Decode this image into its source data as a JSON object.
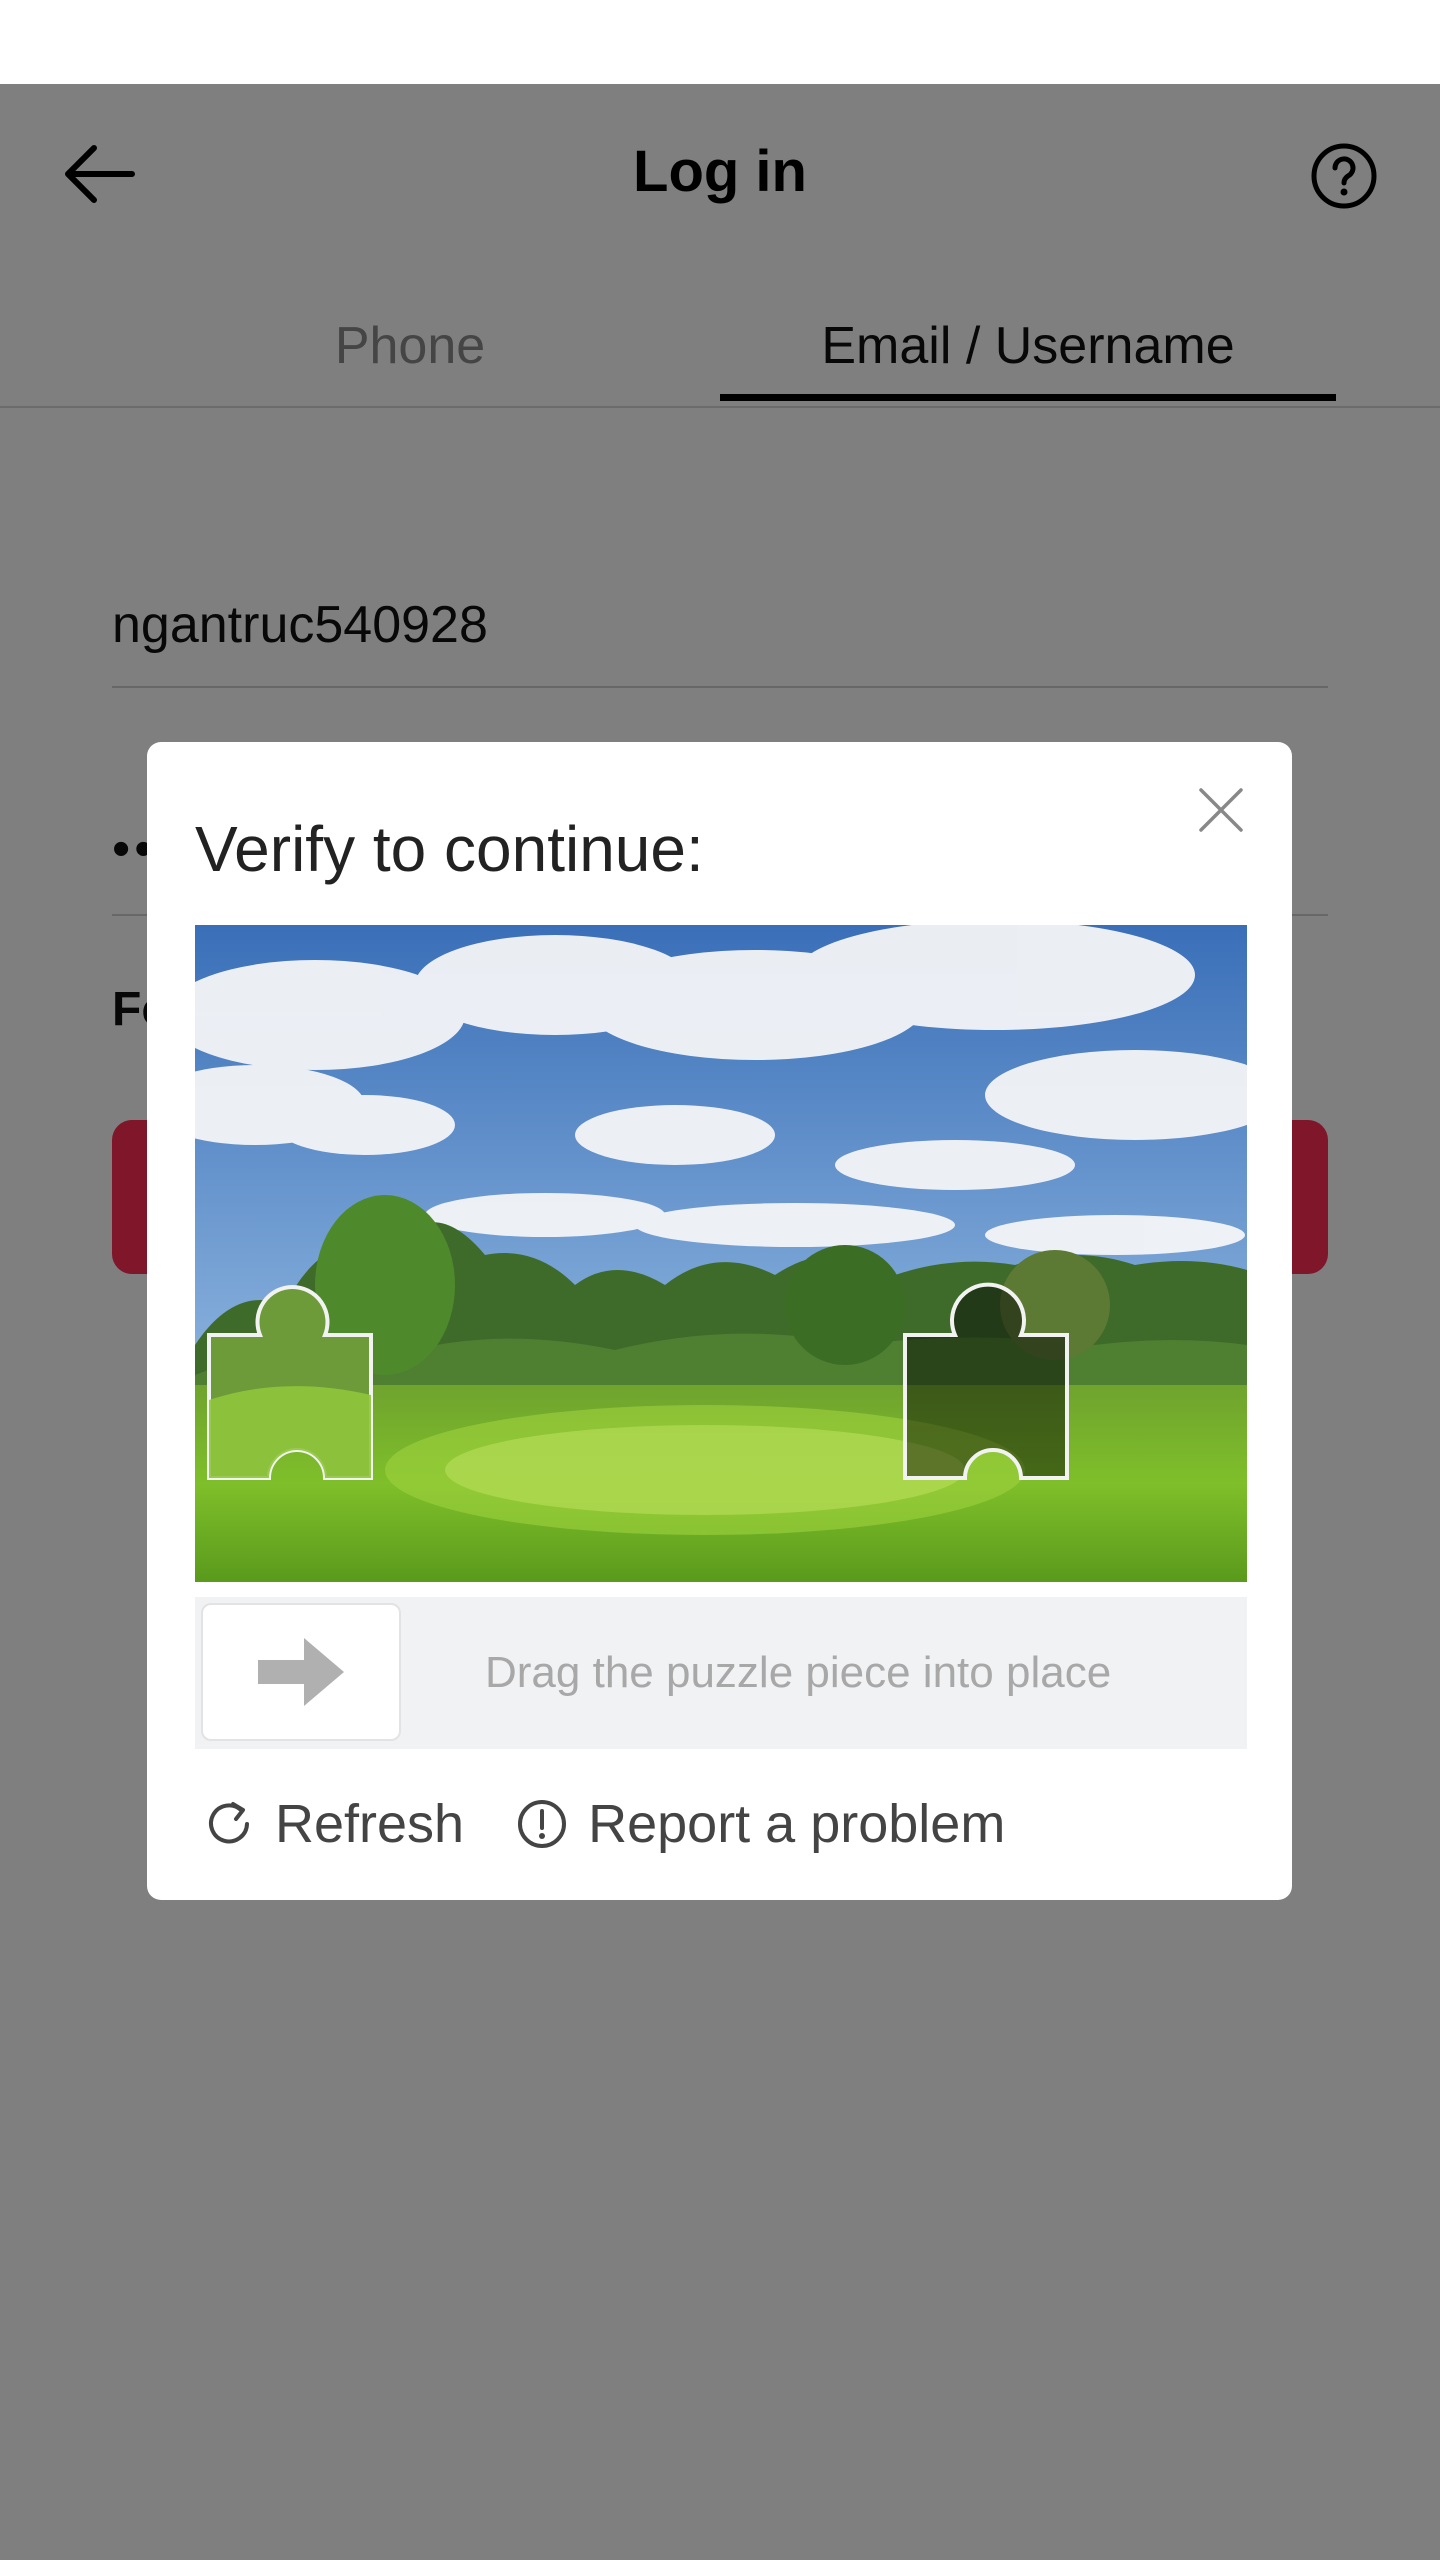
{
  "header": {
    "title": "Log in"
  },
  "tabs": [
    {
      "label": "Phone",
      "active": false
    },
    {
      "label": "Email / Username",
      "active": true
    }
  ],
  "form": {
    "username_value": "ngantruc540928",
    "password_value": "••",
    "forgot_partial": "Fo"
  },
  "captcha": {
    "title": "Verify to continue:",
    "slider_hint": "Drag the puzzle piece into place",
    "refresh_label": "Refresh",
    "report_label": "Report a problem"
  },
  "colors": {
    "accent": "#fe2c55",
    "overlay": "rgba(0,0,0,0.5)"
  }
}
